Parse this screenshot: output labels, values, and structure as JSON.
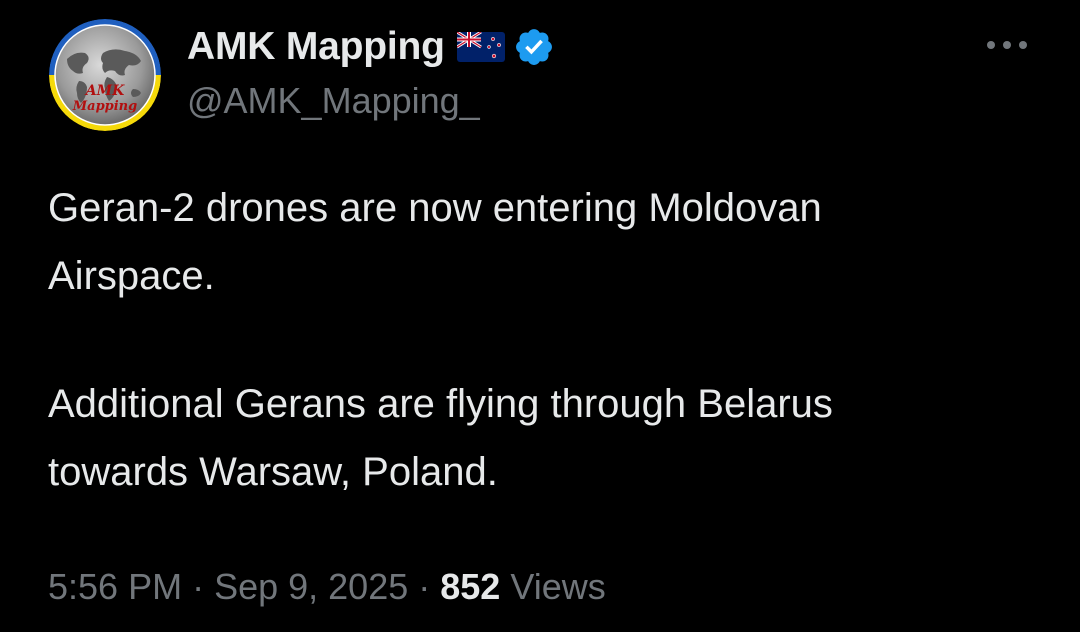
{
  "author": {
    "display_name": "AMK Mapping",
    "handle": "@AMK_Mapping_",
    "flag_icon": "new-zealand-flag",
    "verified_icon": "verified-badge",
    "avatar_text_line1": "AMK",
    "avatar_text_line2": "Mapping"
  },
  "tweet": {
    "lines": [
      "Geran-2 drones are now entering Moldovan",
      "Airspace.",
      "Additional Gerans are flying through Belarus",
      "towards Warsaw, Poland."
    ]
  },
  "meta": {
    "time": "5:56 PM",
    "separator": "·",
    "date": "Sep 9, 2025",
    "views_count": "852",
    "views_label": "Views"
  },
  "colors": {
    "background": "#000000",
    "text_primary": "#e7e9ea",
    "text_secondary": "#71767b",
    "verified_blue": "#1d9bf0",
    "avatar_ring_blue": "#1f5fbf",
    "avatar_ring_yellow": "#f5d90a"
  },
  "icons": {
    "more": "more-horizontal-icon"
  }
}
